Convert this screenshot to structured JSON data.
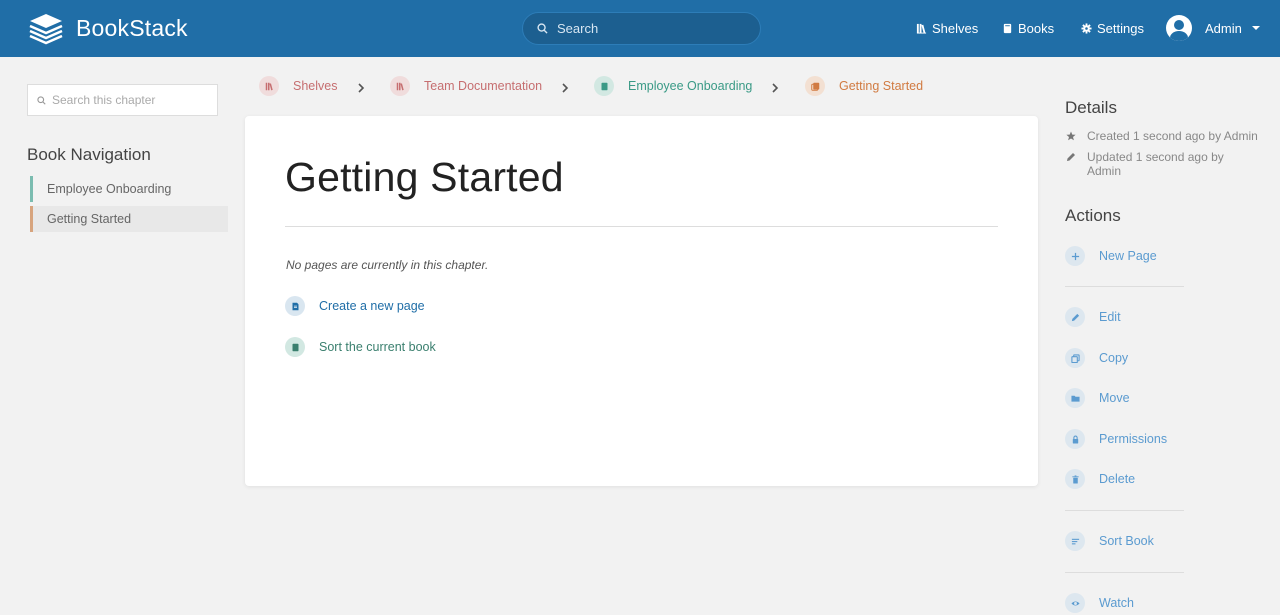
{
  "header": {
    "app_name": "BookStack",
    "search_placeholder": "Search",
    "nav": {
      "shelves": "Shelves",
      "books": "Books",
      "settings": "Settings"
    },
    "user_name": "Admin"
  },
  "sidebar": {
    "search_placeholder": "Search this chapter",
    "book_navigation_title": "Book Navigation",
    "items": [
      {
        "label": "Employee Onboarding"
      },
      {
        "label": "Getting Started"
      }
    ]
  },
  "breadcrumb": {
    "shelves": "Shelves",
    "book": "Team Documentation",
    "chapter": "Employee Onboarding",
    "page": "Getting Started"
  },
  "main": {
    "title": "Getting Started",
    "empty_message": "No pages are currently in this chapter.",
    "create_page": "Create a new page",
    "sort_book": "Sort the current book"
  },
  "details": {
    "title": "Details",
    "created": "Created 1 second ago by Admin",
    "updated": "Updated 1 second ago by Admin"
  },
  "actions": {
    "title": "Actions",
    "new_page": "New Page",
    "edit": "Edit",
    "copy": "Copy",
    "move": "Move",
    "permissions": "Permissions",
    "delete": "Delete",
    "sort_book": "Sort Book",
    "watch": "Watch"
  },
  "colors": {
    "header_bg": "#206ea7",
    "shelf": "#c66e70",
    "chapter": "#3a9a86",
    "page": "#d17b42",
    "link": "#206ea7"
  }
}
